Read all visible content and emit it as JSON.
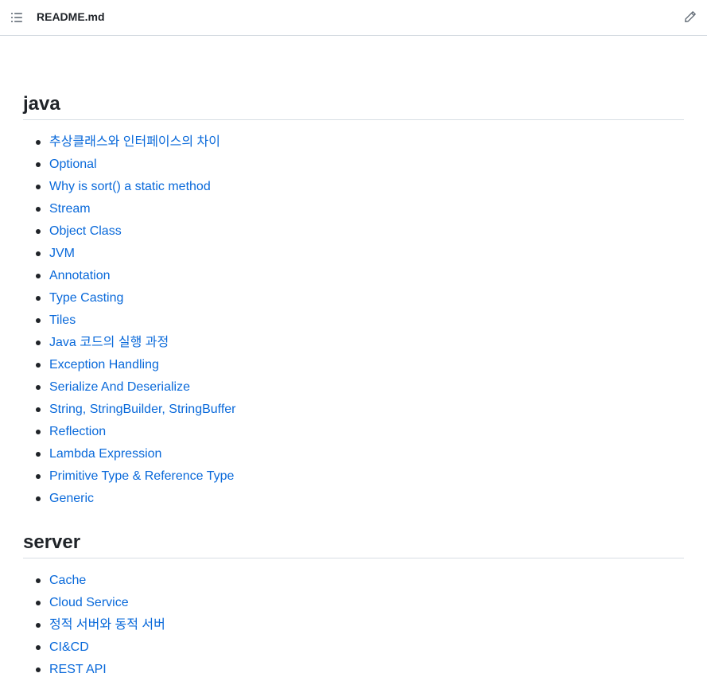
{
  "header": {
    "file_name": "README.md",
    "toc_icon": "list-unordered-icon",
    "edit_icon": "pencil-icon"
  },
  "sections": [
    {
      "title": "java",
      "items": [
        "추상클래스와 인터페이스의 차이",
        "Optional",
        "Why is sort() a static method",
        "Stream",
        "Object Class",
        "JVM",
        "Annotation",
        "Type Casting",
        "Tiles",
        "Java 코드의 실행 과정",
        "Exception Handling",
        "Serialize And Deserialize",
        "String, StringBuilder, StringBuffer",
        "Reflection",
        "Lambda Expression",
        "Primitive Type & Reference Type",
        "Generic"
      ]
    },
    {
      "title": "server",
      "items": [
        "Cache",
        "Cloud Service",
        "정적 서버와 동적 서버",
        "CI&CD",
        "REST API"
      ]
    }
  ],
  "colors": {
    "link": "#0969da",
    "text": "#1f2328",
    "border": "#d0d7de"
  }
}
